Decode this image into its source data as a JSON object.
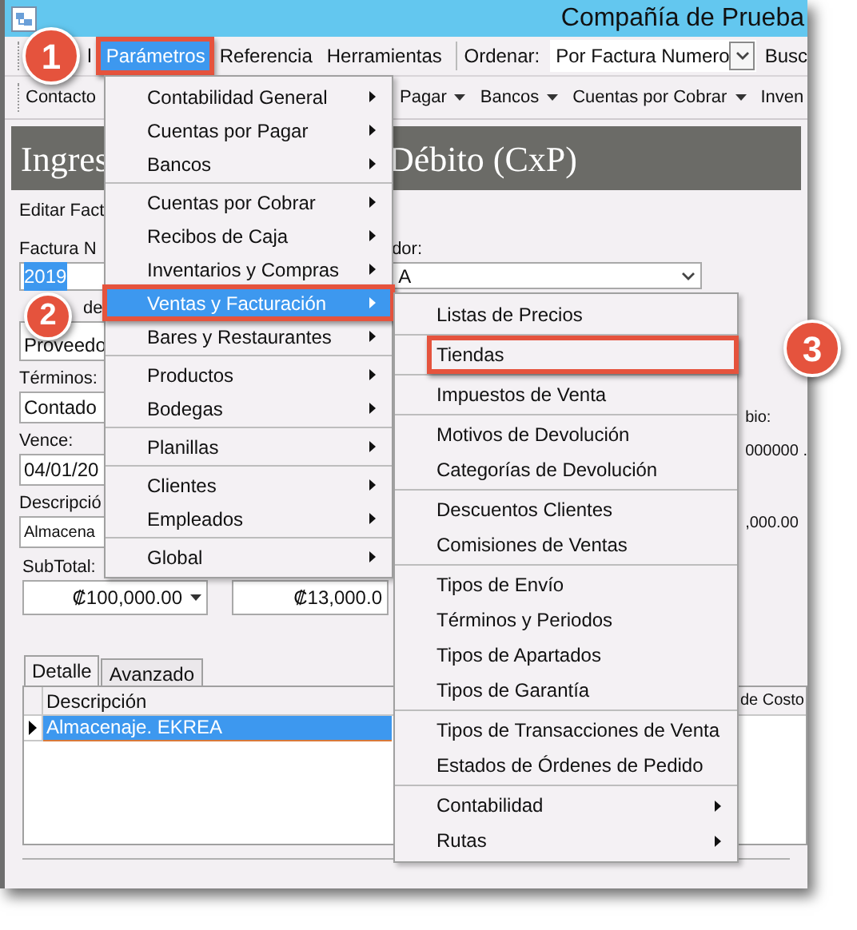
{
  "window": {
    "title": "Compañía de Prueba"
  },
  "menubar": {
    "items": [
      {
        "label": "l",
        "selected": false,
        "marked": false
      },
      {
        "label": "Parámetros",
        "selected": true,
        "marked": true
      },
      {
        "label": "Referencia",
        "selected": false,
        "marked": false
      },
      {
        "label": "Herramientas",
        "selected": false,
        "marked": false
      }
    ],
    "sort_label": "Ordenar:",
    "sort_value": "Por Factura Numero",
    "search_label": "Busc"
  },
  "toolbar": {
    "items": [
      {
        "label": "Contacto",
        "dropdown": false
      },
      {
        "label": "Pagar",
        "dropdown": true
      },
      {
        "label": "Bancos",
        "dropdown": true
      },
      {
        "label": "Cuentas por Cobrar",
        "dropdown": true
      },
      {
        "label": "Inven",
        "dropdown": false
      }
    ]
  },
  "header": {
    "title_left": "Ingres",
    "title_right": "Débito (CxP)"
  },
  "section_label": "Editar Fact",
  "form": {
    "invoice_label": "Factura N",
    "invoice_value": "2019",
    "invoice_selected": true,
    "supplier_label": "dor:",
    "supplier_value": "A",
    "type_label": "de",
    "type_value": "Proveedo",
    "terms_label": "Términos:",
    "terms_value": "Contado",
    "due_label": "Vence:",
    "due_value": "04/01/20",
    "description_label": "Descripció",
    "description_value": "Almacena",
    "subtotal_label": "SubTotal:",
    "subtotal_value": "₡100,000.00",
    "tax_value": "₡13,000.0",
    "rate_label": "bio:",
    "rate_value": "000000 .",
    "total_value": ",000.00"
  },
  "tabs": [
    {
      "label": "Detalle",
      "selected": true
    },
    {
      "label": "Avanzado",
      "selected": false
    }
  ],
  "grid": {
    "columns": [
      "Descripción",
      "de Costo"
    ],
    "rows": [
      {
        "cells": [
          "Almacenaje. EKREA"
        ],
        "selected": true
      }
    ]
  },
  "menus": [
    {
      "items": [
        {
          "kind": "item",
          "label": "Contabilidad General",
          "submenu": true,
          "selected": false,
          "marked": false
        },
        {
          "kind": "item",
          "label": "Cuentas por Pagar",
          "submenu": true,
          "selected": false,
          "marked": false
        },
        {
          "kind": "item",
          "label": "Bancos",
          "submenu": true,
          "selected": false,
          "marked": false
        },
        {
          "kind": "separator"
        },
        {
          "kind": "item",
          "label": "Cuentas por Cobrar",
          "submenu": true,
          "selected": false,
          "marked": false
        },
        {
          "kind": "item",
          "label": "Recibos de Caja",
          "submenu": true,
          "selected": false,
          "marked": false
        },
        {
          "kind": "item",
          "label": "Inventarios y Compras",
          "submenu": true,
          "selected": false,
          "marked": false
        },
        {
          "kind": "item",
          "label": "Ventas y Facturación",
          "submenu": true,
          "selected": true,
          "marked": true
        },
        {
          "kind": "item",
          "label": "Bares y Restaurantes",
          "submenu": true,
          "selected": false,
          "marked": false
        },
        {
          "kind": "separator"
        },
        {
          "kind": "item",
          "label": "Productos",
          "submenu": true,
          "selected": false,
          "marked": false
        },
        {
          "kind": "item",
          "label": "Bodegas",
          "submenu": true,
          "selected": false,
          "marked": false
        },
        {
          "kind": "separator"
        },
        {
          "kind": "item",
          "label": "Planillas",
          "submenu": true,
          "selected": false,
          "marked": false
        },
        {
          "kind": "separator"
        },
        {
          "kind": "item",
          "label": "Clientes",
          "submenu": true,
          "selected": false,
          "marked": false
        },
        {
          "kind": "item",
          "label": "Empleados",
          "submenu": true,
          "selected": false,
          "marked": false
        },
        {
          "kind": "separator"
        },
        {
          "kind": "item",
          "label": "Global",
          "submenu": true,
          "selected": false,
          "marked": false
        }
      ]
    },
    {
      "items": [
        {
          "kind": "item",
          "label": "Listas de Precios",
          "submenu": false,
          "selected": false,
          "marked": false
        },
        {
          "kind": "separator"
        },
        {
          "kind": "item",
          "label": "Tiendas",
          "submenu": false,
          "selected": false,
          "marked": true
        },
        {
          "kind": "separator"
        },
        {
          "kind": "item",
          "label": "Impuestos de Venta",
          "submenu": false,
          "selected": false,
          "marked": false
        },
        {
          "kind": "separator"
        },
        {
          "kind": "item",
          "label": "Motivos de Devolución",
          "submenu": false,
          "selected": false,
          "marked": false
        },
        {
          "kind": "item",
          "label": "Categorías de Devolución",
          "submenu": false,
          "selected": false,
          "marked": false
        },
        {
          "kind": "separator"
        },
        {
          "kind": "item",
          "label": "Descuentos Clientes",
          "submenu": false,
          "selected": false,
          "marked": false
        },
        {
          "kind": "item",
          "label": "Comisiones de Ventas",
          "submenu": false,
          "selected": false,
          "marked": false
        },
        {
          "kind": "separator"
        },
        {
          "kind": "item",
          "label": "Tipos de Envío",
          "submenu": false,
          "selected": false,
          "marked": false
        },
        {
          "kind": "item",
          "label": "Términos y Periodos",
          "submenu": false,
          "selected": false,
          "marked": false
        },
        {
          "kind": "item",
          "label": "Tipos de Apartados",
          "submenu": false,
          "selected": false,
          "marked": false
        },
        {
          "kind": "item",
          "label": "Tipos de Garantía",
          "submenu": false,
          "selected": false,
          "marked": false
        },
        {
          "kind": "separator"
        },
        {
          "kind": "item",
          "label": "Tipos de Transacciones de Venta",
          "submenu": false,
          "selected": false,
          "marked": false
        },
        {
          "kind": "item",
          "label": "Estados de Órdenes de Pedido",
          "submenu": false,
          "selected": false,
          "marked": false
        },
        {
          "kind": "separator"
        },
        {
          "kind": "item",
          "label": "Contabilidad",
          "submenu": true,
          "selected": false,
          "marked": false
        },
        {
          "kind": "item",
          "label": "Rutas",
          "submenu": true,
          "selected": false,
          "marked": false
        }
      ]
    }
  ],
  "callouts": [
    {
      "number": "1"
    },
    {
      "number": "2"
    },
    {
      "number": "3"
    }
  ]
}
